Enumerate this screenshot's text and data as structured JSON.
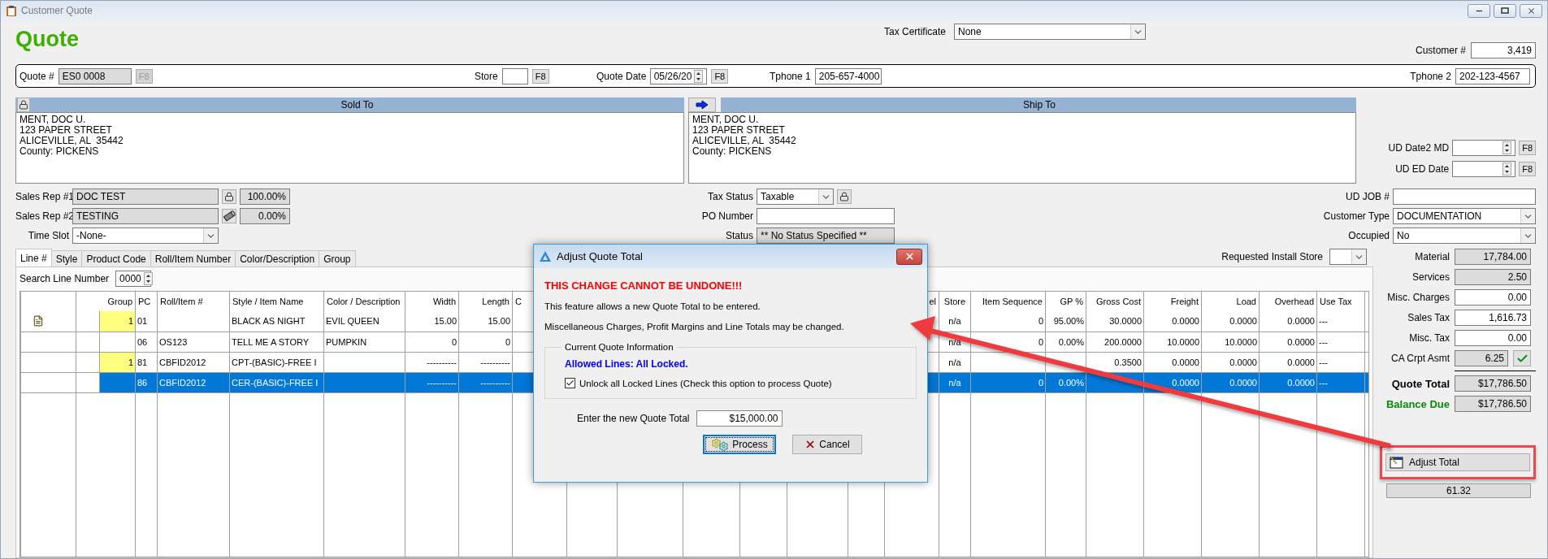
{
  "window": {
    "title": "Customer Quote"
  },
  "heading": "Quote",
  "tax_certificate": {
    "label": "Tax Certificate",
    "value": "None"
  },
  "customer_number": {
    "label": "Customer #",
    "value": "3,419"
  },
  "quote_bar": [
    {
      "label": "Quote #",
      "value": "ES0 0008",
      "readonly": true,
      "spin": false,
      "button": {
        "label": "F8",
        "disabled": true
      }
    },
    {
      "label": "Store",
      "readonly": false,
      "spin": false,
      "button": {
        "label": "F8",
        "disabled": false
      }
    },
    {
      "label": "Quote Date",
      "value": "05/26/20",
      "readonly": false,
      "spin": true,
      "button": {
        "label": "F8",
        "disabled": false
      }
    },
    {
      "label": "Tphone 1",
      "value": "205-657-4000",
      "readonly": false,
      "spin": false
    },
    {
      "label": "Tphone 2",
      "value": "202-123-4567",
      "readonly": false,
      "spin": false
    }
  ],
  "sold_to": {
    "title": "Sold To",
    "lines": [
      "MENT, DOC U.",
      "123 PAPER STREET",
      "ALICEVILLE, AL  35442",
      "County: PICKENS"
    ]
  },
  "ship_to": {
    "title": "Ship To",
    "lines": [
      "MENT, DOC U.",
      "123 PAPER STREET",
      "ALICEVILLE, AL  35442",
      "County: PICKENS"
    ]
  },
  "ud_dates": [
    {
      "label": "UD Date2 MD",
      "button": "F8"
    },
    {
      "label": "UD ED Date",
      "button": "F8"
    }
  ],
  "sales_reps": [
    {
      "label": "Sales Rep #1",
      "value": "DOC TEST",
      "kind": "lock",
      "percent": "100.00%"
    },
    {
      "label": "Sales Rep #2",
      "value": "TESTING",
      "kind": "tube",
      "percent": "0.00%"
    }
  ],
  "time_slot": {
    "label": "Time Slot",
    "value": "-None-"
  },
  "tax_fields": [
    {
      "label": "Tax Status",
      "value": "Taxable",
      "kind": "dropdown"
    },
    {
      "label": "PO Number",
      "kind": "text"
    },
    {
      "label": "Status",
      "value": "** No Status Specified **",
      "kind": "readonly"
    }
  ],
  "customer_fields": [
    {
      "label": "UD JOB #",
      "kind": "text"
    },
    {
      "label": "Customer Type",
      "value": "DOCUMENTATION",
      "kind": "dropdown"
    },
    {
      "label": "Occupied",
      "value": "No",
      "kind": "dropdown"
    }
  ],
  "tabs": [
    {
      "label": "Line #",
      "selected": true
    },
    {
      "label": "Style",
      "selected": false
    },
    {
      "label": "Product Code",
      "selected": false
    },
    {
      "label": "Roll/Item Number",
      "selected": false
    },
    {
      "label": "Color/Description",
      "selected": false
    },
    {
      "label": "Group",
      "selected": false
    }
  ],
  "requested_install_store": {
    "label": "Requested Install Store"
  },
  "search_line": {
    "label": "Search Line Number",
    "value": "0000"
  },
  "table": {
    "columns": [
      {
        "kind": "blank"
      },
      {
        "kind": "blank"
      },
      {
        "kind": "label",
        "label": "Group"
      },
      {
        "kind": "label",
        "label": "PC"
      },
      {
        "kind": "label",
        "label": "Roll/Item #"
      },
      {
        "kind": "label",
        "label": "Style / Item Name"
      },
      {
        "kind": "label",
        "label": "Color / Description"
      },
      {
        "kind": "label",
        "label": "Width"
      },
      {
        "kind": "label",
        "label": "Length"
      },
      {
        "kind": "label",
        "label": "C"
      },
      {
        "kind": "blank"
      },
      {
        "kind": "blank"
      },
      {
        "kind": "blank"
      },
      {
        "kind": "blank"
      },
      {
        "kind": "blank"
      },
      {
        "kind": "blank"
      },
      {
        "kind": "label",
        "label": "el"
      },
      {
        "kind": "label",
        "label": "Store"
      },
      {
        "kind": "label",
        "label": "Item Sequence"
      },
      {
        "kind": "label",
        "label": "GP %"
      },
      {
        "kind": "label",
        "label": "Gross Cost"
      },
      {
        "kind": "label",
        "label": "Freight"
      },
      {
        "kind": "label",
        "label": "Load"
      },
      {
        "kind": "label",
        "label": "Overhead"
      },
      {
        "kind": "label",
        "label": "Use Tax"
      },
      {
        "kind": "blank"
      }
    ],
    "rows": [
      {
        "note": true,
        "flagged": true,
        "selected": false,
        "cells": [
          null,
          null,
          "1",
          "01",
          null,
          "BLACK AS NIGHT",
          "EVIL QUEEN",
          "15.00",
          "15.00",
          null,
          null,
          null,
          null,
          null,
          null,
          null,
          null,
          "n/a",
          "0",
          "95.00%",
          "30.0000",
          "0.0000",
          "0.0000",
          "0.0000",
          "---",
          null
        ]
      },
      {
        "note": false,
        "flagged": false,
        "selected": false,
        "cells": [
          null,
          null,
          null,
          "06",
          "OS123",
          "TELL ME A STORY",
          "PUMPKIN",
          "0",
          "0",
          null,
          null,
          null,
          null,
          null,
          null,
          null,
          null,
          "n/a",
          "0",
          "0.00%",
          "200.0000",
          "10.0000",
          "10.0000",
          "0.0000",
          "---",
          null
        ]
      },
      {
        "note": false,
        "flagged": true,
        "selected": false,
        "cells": [
          null,
          null,
          "1",
          "81",
          "CBFID2012",
          "CPT-(BASIC)-FREE I",
          null,
          "----------",
          "----------",
          null,
          null,
          null,
          null,
          null,
          null,
          null,
          null,
          "n/a",
          null,
          null,
          "0.3500",
          "0.0000",
          "0.0000",
          "0.0000",
          "---",
          null
        ]
      },
      {
        "note": false,
        "flagged": false,
        "selected": true,
        "cells": [
          null,
          null,
          null,
          "86",
          "CBFID2012",
          "CER-(BASIC)-FREE I",
          null,
          "----------",
          "----------",
          null,
          null,
          null,
          null,
          null,
          null,
          null,
          null,
          "n/a",
          "0",
          "0.00%",
          null,
          "0.0000",
          "0.0000",
          "0.0000",
          "---",
          null
        ]
      }
    ]
  },
  "totals": [
    {
      "label": "Material",
      "value": "17,784.00",
      "kind": "readonly"
    },
    {
      "label": "Services",
      "value": "2.50",
      "kind": "readonly"
    },
    {
      "label": "Misc. Charges",
      "value": "0.00",
      "kind": "input"
    },
    {
      "label": "Sales Tax",
      "value": "1,616.73",
      "kind": "input"
    },
    {
      "label": "Misc. Tax",
      "value": "0.00",
      "kind": "input"
    },
    {
      "label": "CA Crpt Asmt",
      "value": "6.25",
      "kind": "checked"
    },
    {
      "label": "Quote Total",
      "value": "$17,786.50",
      "kind": "total"
    },
    {
      "label": "Balance Due",
      "value": "$17,786.50",
      "kind": "balance"
    }
  ],
  "adjust_button": {
    "label": "Adjust Total"
  },
  "extra_value": "61.32",
  "dialog": {
    "title": "Adjust Quote Total",
    "warning": "THIS CHANGE CANNOT BE UNDONE!!!",
    "paragraphs": [
      "This feature allows a new Quote Total to be entered.",
      "Miscellaneous Charges, Profit Margins and Line Totals may be changed."
    ],
    "group": {
      "title": "Current Quote Information",
      "status": "Allowed Lines: All Locked.",
      "checkbox": {
        "label": "Unlock all Locked Lines (Check this option to process Quote)",
        "checked": true
      }
    },
    "total_field": {
      "label": "Enter the new Quote Total",
      "value": "$15,000.00"
    },
    "buttons": [
      {
        "label": "Process",
        "kind": "process",
        "focused": true
      },
      {
        "label": "Cancel",
        "kind": "cancel",
        "focused": false
      }
    ]
  }
}
